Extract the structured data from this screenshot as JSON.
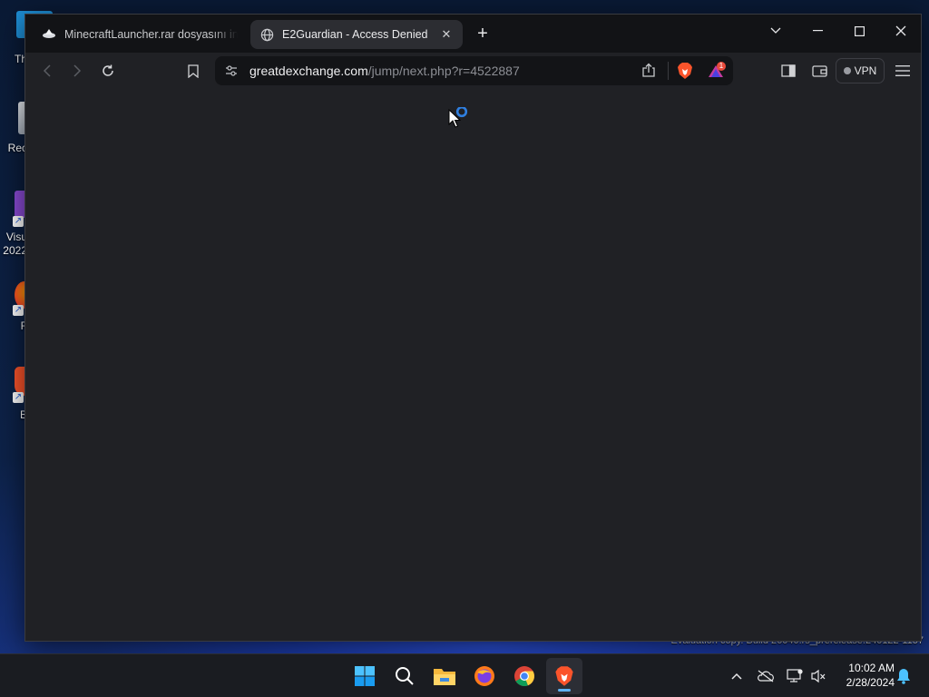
{
  "desktop": {
    "icons": [
      {
        "label": "Th"
      },
      {
        "label": "Rec"
      },
      {
        "label": "Visu"
      },
      {
        "label": "2022"
      },
      {
        "label": "F"
      },
      {
        "label": "B"
      }
    ],
    "watermark": "Evaluation copy. Build 26040.rs_prerelease.240122-1157"
  },
  "browser": {
    "tabs": [
      {
        "title": "MinecraftLauncher.rar dosyasını indir",
        "active": false
      },
      {
        "title": "E2Guardian - Access Denied",
        "active": true
      }
    ],
    "new_tab_label": "+",
    "url": {
      "host": "greatdexchange.com",
      "path": "/jump/next.php?r=4522887"
    },
    "vpn_label": "VPN",
    "brave_rewards_badge": "1"
  },
  "taskbar": {
    "apps": [
      {
        "name": "start",
        "icon": "windows-logo-icon"
      },
      {
        "name": "search",
        "icon": "search-icon"
      },
      {
        "name": "file-explorer",
        "icon": "folder-icon"
      },
      {
        "name": "firefox",
        "icon": "firefox-icon"
      },
      {
        "name": "chrome",
        "icon": "chrome-icon"
      },
      {
        "name": "brave",
        "icon": "brave-icon",
        "active": true
      }
    ],
    "clock": {
      "time": "10:02 AM",
      "date": "2/28/2024"
    }
  },
  "colors": {
    "brave_orange": "#fb542b",
    "accent_blue": "#3b8ee8",
    "window_bg": "#202125"
  }
}
